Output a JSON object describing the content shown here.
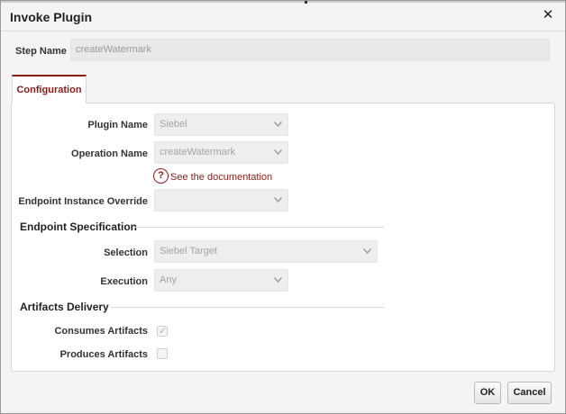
{
  "dialog": {
    "title": "Invoke Plugin",
    "close_glyph": "✕"
  },
  "step": {
    "label": "Step Name",
    "value": "createWatermark"
  },
  "tabs": [
    {
      "label": "Configuration",
      "active": true
    }
  ],
  "fields": {
    "plugin_name": {
      "label": "Plugin Name",
      "value": "Siebel"
    },
    "operation_name": {
      "label": "Operation Name",
      "value": "createWatermark"
    },
    "documentation_link": "See the documentation",
    "endpoint_override": {
      "label": "Endpoint Instance Override",
      "value": ""
    }
  },
  "endpoint_spec": {
    "heading": "Endpoint Specification",
    "selection": {
      "label": "Selection",
      "value": "Siebel Target"
    },
    "execution": {
      "label": "Execution",
      "value": "Any"
    }
  },
  "artifacts": {
    "heading": "Artifacts Delivery",
    "consumes": {
      "label": "Consumes Artifacts",
      "checked": true
    },
    "produces": {
      "label": "Produces Artifacts",
      "checked": false
    }
  },
  "buttons": {
    "ok": "OK",
    "cancel": "Cancel"
  },
  "icons": {
    "help": "?",
    "check": "✓"
  },
  "colors": {
    "accent": "#8c1c14",
    "disabled_field": "#eeeeee",
    "panel_border": "#d7d7d7"
  }
}
